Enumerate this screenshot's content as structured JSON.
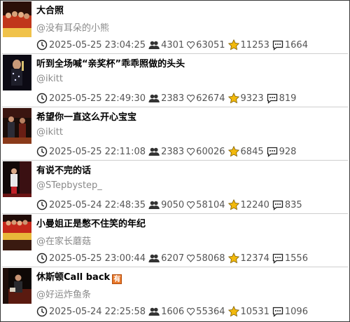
{
  "icons": {
    "clock": "clock-icon",
    "viewers": "people-icon",
    "likes": "heart-icon",
    "stars": "star-icon",
    "comments": "comment-icon"
  },
  "colors": {
    "star": "#f2b90c",
    "badge": "#e8782a",
    "author": "#8a8a8a",
    "divider": "#cfcfcf"
  },
  "items": [
    {
      "title": "大合照",
      "author": "@没有耳朵的小熊",
      "time": "2025-05-25 23:04:25",
      "viewers": "4301",
      "likes": "63051",
      "stars": "11253",
      "comments": "1664",
      "badge": ""
    },
    {
      "title": "听到全场喊“亲奖杯”乖乖照做的头头",
      "author": "@ikitt",
      "time": "2025-05-25 22:49:30",
      "viewers": "2383",
      "likes": "62674",
      "stars": "9323",
      "comments": "819",
      "badge": ""
    },
    {
      "title": "希望你一直这么开心宝宝",
      "author": "@ikitt",
      "time": "2025-05-25 22:11:08",
      "viewers": "2383",
      "likes": "60026",
      "stars": "6845",
      "comments": "928",
      "badge": ""
    },
    {
      "title": "有说不完的话",
      "author": "@STepbystep_",
      "time": "2025-05-24 22:48:35",
      "viewers": "9050",
      "likes": "58104",
      "stars": "12240",
      "comments": "835",
      "badge": ""
    },
    {
      "title": "小曼姐正是憋不住笑的年纪",
      "author": "@在家长蘑菇",
      "time": "2025-05-25 23:00:44",
      "viewers": "6207",
      "likes": "58068",
      "stars": "12374",
      "comments": "1556",
      "badge": ""
    },
    {
      "title": "休斯顿Call back",
      "author": "@好运炸鱼条",
      "time": "2025-05-24 22:25:58",
      "viewers": "1606",
      "likes": "55364",
      "stars": "10531",
      "comments": "1096",
      "badge": "有"
    }
  ]
}
